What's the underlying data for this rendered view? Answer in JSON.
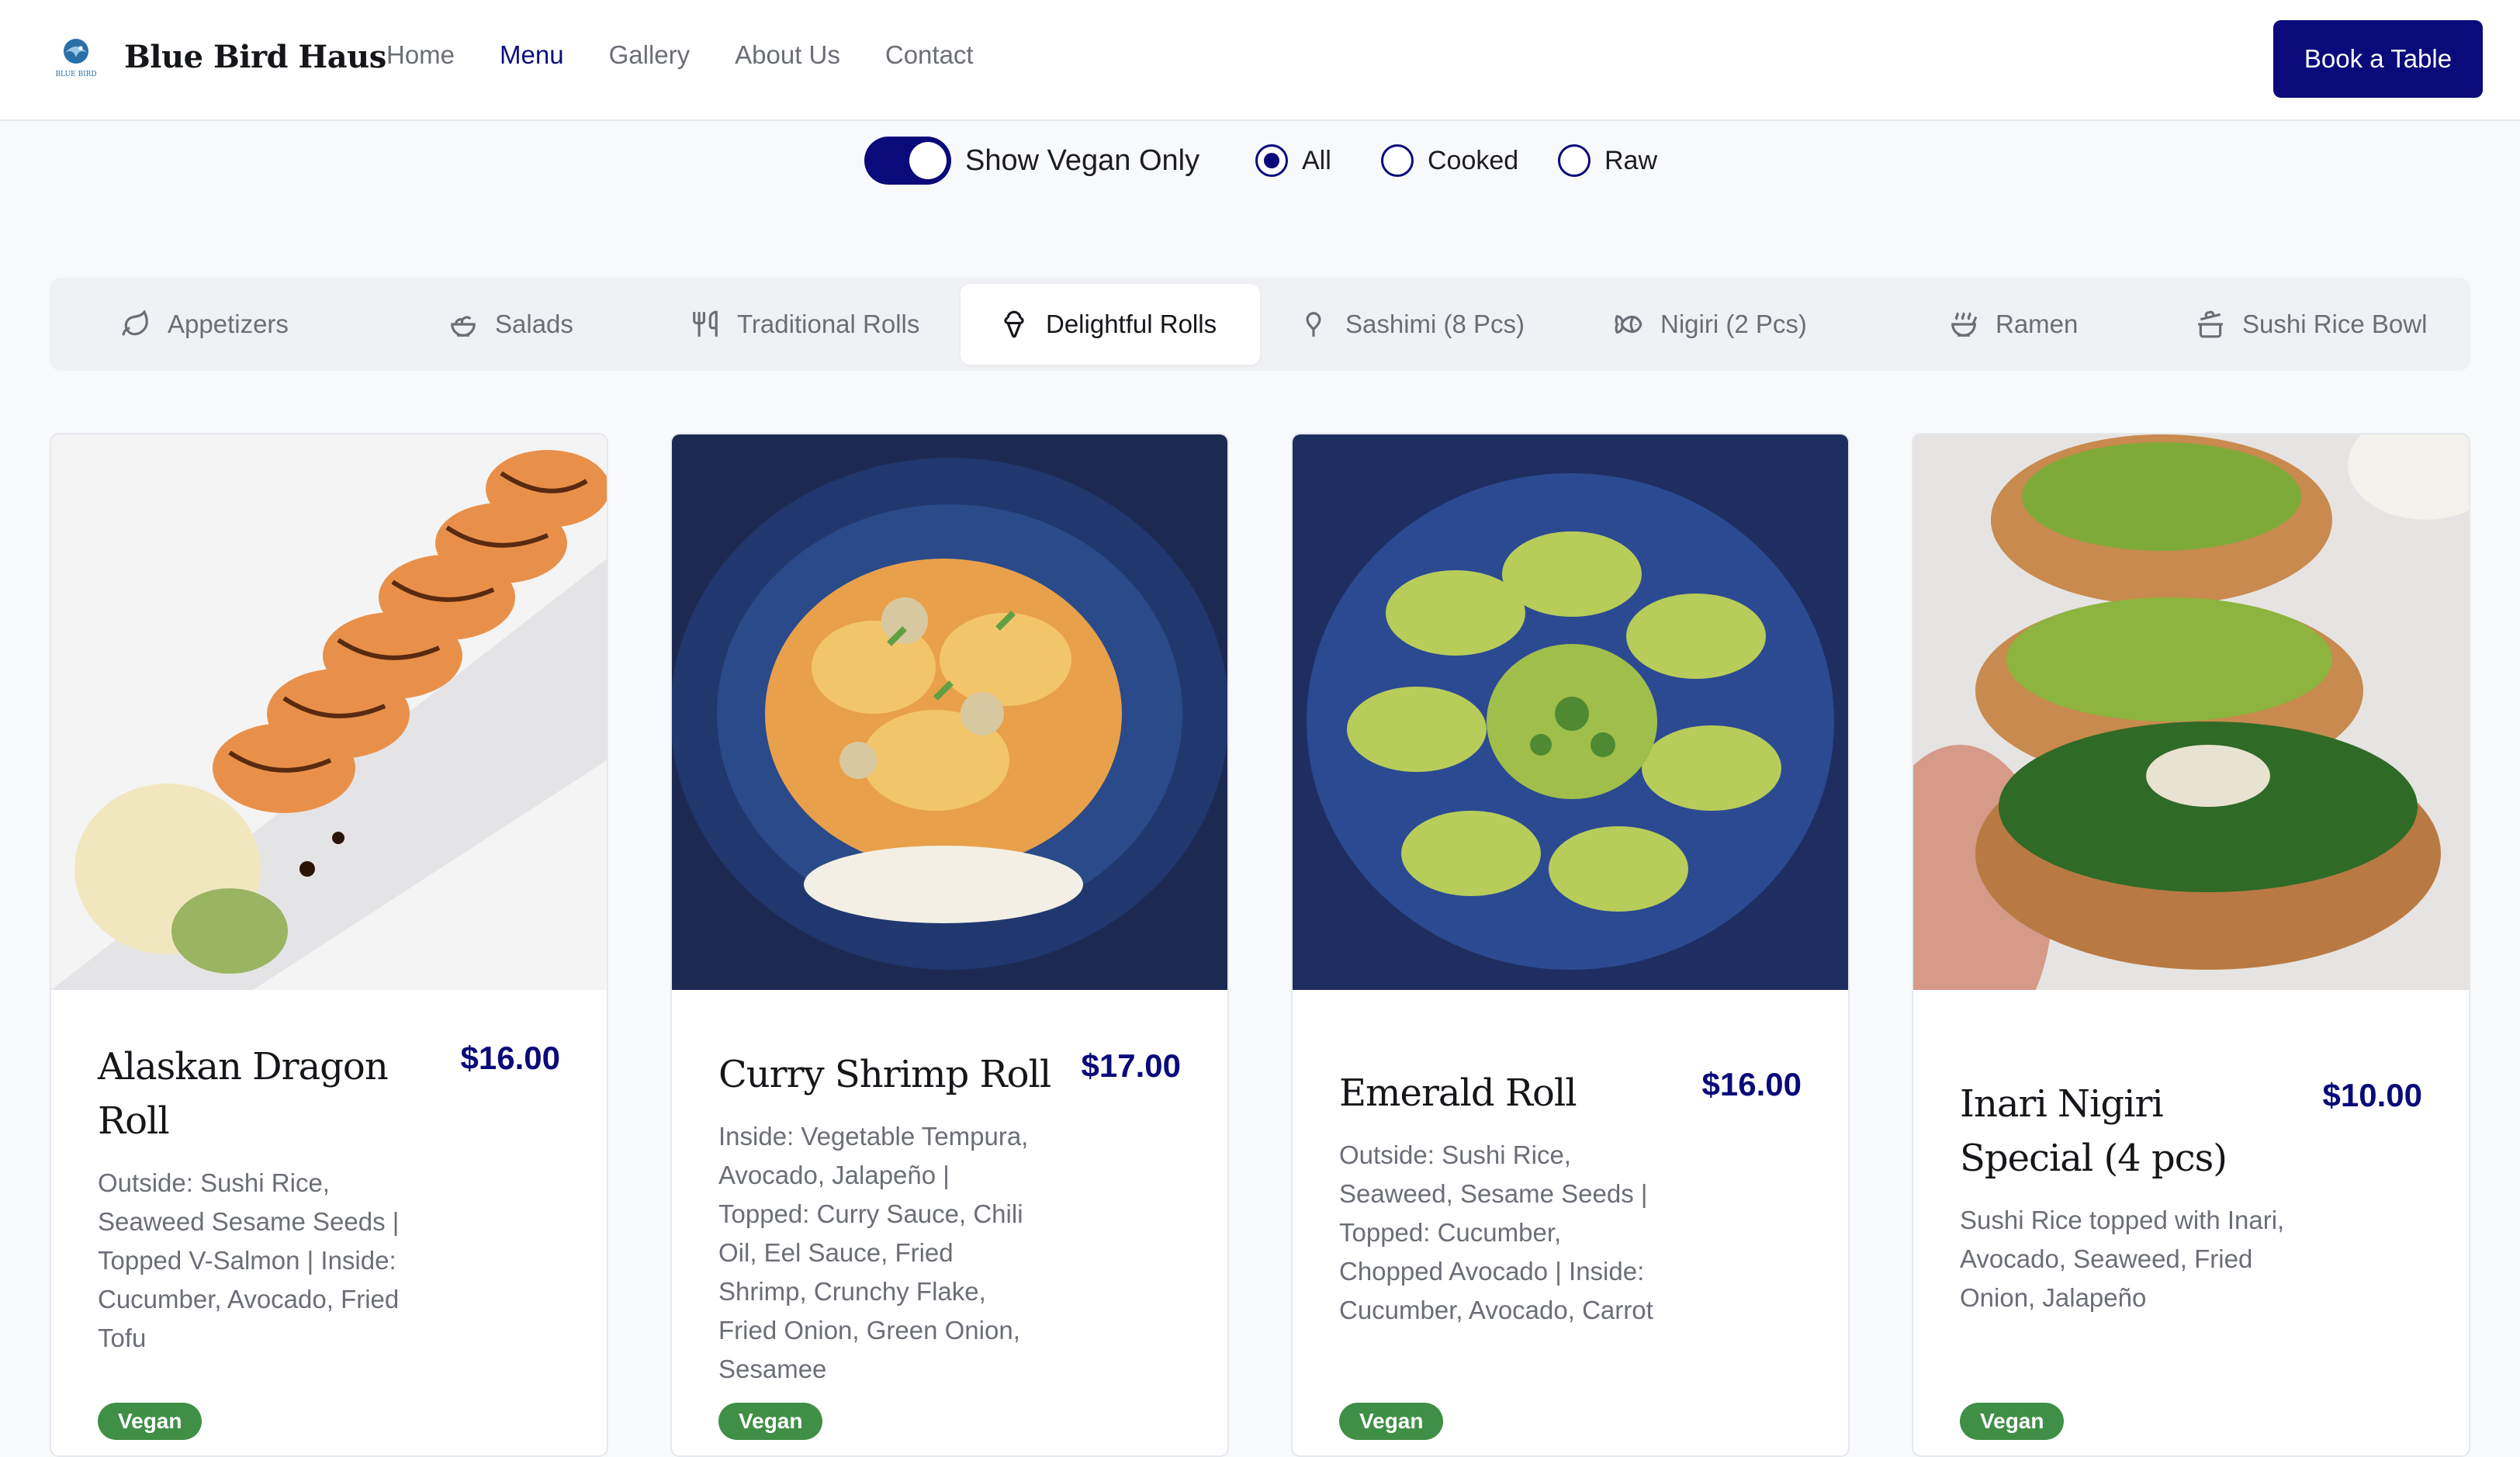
{
  "header": {
    "brand": "Blue Bird Haus",
    "logo_caption": "BLUE BIRD",
    "nav": [
      "Home",
      "Menu",
      "Gallery",
      "About Us",
      "Contact"
    ],
    "active_nav": "Menu",
    "cta": "Book a Table"
  },
  "filters": {
    "vegan_toggle_label": "Show Vegan Only",
    "vegan_toggle_on": true,
    "radios": [
      "All",
      "Cooked",
      "Raw"
    ],
    "selected": "All"
  },
  "tabs": [
    {
      "label": "Appetizers",
      "icon": "leaf-icon"
    },
    {
      "label": "Salads",
      "icon": "salad-icon"
    },
    {
      "label": "Traditional Rolls",
      "icon": "utensils-icon"
    },
    {
      "label": "Delightful Rolls",
      "icon": "ice-cream-icon"
    },
    {
      "label": "Sashimi (8 Pcs)",
      "icon": "popsicle-icon"
    },
    {
      "label": "Nigiri (2 Pcs)",
      "icon": "fish-icon"
    },
    {
      "label": "Ramen",
      "icon": "soup-icon"
    },
    {
      "label": "Sushi Rice Bowl",
      "icon": "cooking-pot-icon"
    }
  ],
  "active_tab": "Delightful Rolls",
  "cards": [
    {
      "name": "Alaskan Dragon Roll",
      "price": "$16.00",
      "desc": "Outside: Sushi Rice, Seaweed Sesame Seeds | Topped V-Salmon | Inside: Cucumber, Avocado, Fried Tofu",
      "badge": "Vegan"
    },
    {
      "name": "Curry Shrimp Roll",
      "price": "$17.00",
      "desc": "Inside: Vegetable Tempura, Avocado, Jalapeño | Topped: Curry Sauce, Chili Oil, Eel Sauce, Fried Shrimp, Crunchy Flake, Fried Onion, Green Onion, Sesamee",
      "badge": "Vegan"
    },
    {
      "name": "Emerald Roll",
      "price": "$16.00",
      "desc": "Outside: Sushi Rice, Seaweed, Sesame Seeds | Topped: Cucumber, Chopped Avocado | Inside: Cucumber, Avocado, Carrot",
      "badge": "Vegan"
    },
    {
      "name": "Inari Nigiri Special (4 pcs)",
      "price": "$10.00",
      "desc": "Sushi Rice topped with Inari, Avocado, Seaweed, Fried Onion, Jalapeño",
      "badge": "Vegan"
    }
  ],
  "colors": {
    "accent": "#0a0a7a",
    "vegan_badge": "#3f8f46",
    "muted_text": "#6b6e76"
  }
}
